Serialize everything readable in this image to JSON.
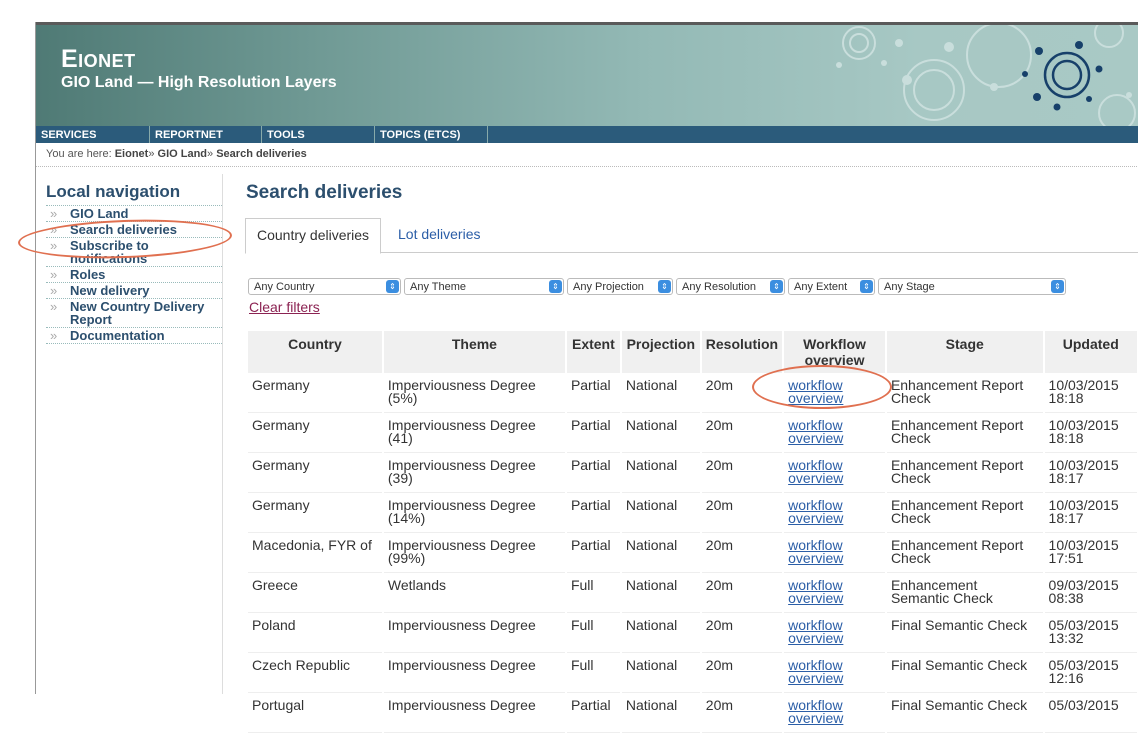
{
  "site": {
    "logo": "Eionet",
    "subtitle": "GIO Land — High Resolution Layers"
  },
  "topnav": [
    "SERVICES",
    "REPORTNET",
    "TOOLS",
    "TOPICS (ETCS)"
  ],
  "breadcrumb": {
    "prefix": "You are here:",
    "items": [
      "Eionet",
      "GIO Land",
      "Search deliveries"
    ],
    "separator": "»"
  },
  "localnav": {
    "title": "Local navigation",
    "items": [
      "GIO Land",
      "Search deliveries",
      "Subscribe to notifications",
      "Roles",
      "New delivery",
      "New Country Delivery Report",
      "Documentation"
    ]
  },
  "page": {
    "title": "Search deliveries",
    "tabs": [
      "Country deliveries",
      "Lot deliveries"
    ]
  },
  "filters": {
    "selects": [
      "Any Country",
      "Any Theme",
      "Any Projection",
      "Any Resolution",
      "Any Extent",
      "Any Stage"
    ],
    "clear": "Clear filters"
  },
  "table": {
    "headers": [
      "Country",
      "Theme",
      "Extent",
      "Projection",
      "Resolution",
      "Workflow overview",
      "Stage",
      "Updated"
    ],
    "rows": [
      [
        "Germany",
        "Imperviousness Degree (5%)",
        "Partial",
        "National",
        "20m",
        "workflow overview",
        "Enhancement Report Check",
        "10/03/2015 18:18"
      ],
      [
        "Germany",
        "Imperviousness Degree (41)",
        "Partial",
        "National",
        "20m",
        "workflow overview",
        "Enhancement Report Check",
        "10/03/2015 18:18"
      ],
      [
        "Germany",
        "Imperviousness Degree (39)",
        "Partial",
        "National",
        "20m",
        "workflow overview",
        "Enhancement Report Check",
        "10/03/2015 18:17"
      ],
      [
        "Germany",
        "Imperviousness Degree (14%)",
        "Partial",
        "National",
        "20m",
        "workflow overview",
        "Enhancement Report Check",
        "10/03/2015 18:17"
      ],
      [
        "Macedonia, FYR of",
        "Imperviousness Degree (99%)",
        "Partial",
        "National",
        "20m",
        "workflow overview",
        "Enhancement Report Check",
        "10/03/2015 17:51"
      ],
      [
        "Greece",
        "Wetlands",
        "Full",
        "National",
        "20m",
        "workflow overview",
        "Enhancement Semantic Check",
        "09/03/2015 08:38"
      ],
      [
        "Poland",
        "Imperviousness Degree",
        "Full",
        "National",
        "20m",
        "workflow overview",
        "Final Semantic Check",
        "05/03/2015 13:32"
      ],
      [
        "Czech Republic",
        "Imperviousness Degree",
        "Full",
        "National",
        "20m",
        "workflow overview",
        "Final Semantic Check",
        "05/03/2015 12:16"
      ],
      [
        "Portugal",
        "Imperviousness Degree",
        "Partial",
        "National",
        "20m",
        "workflow overview",
        "Final Semantic Check",
        "05/03/2015"
      ]
    ]
  },
  "colors": {
    "nav_bg": "#2b5b7b",
    "heading": "#2c4f6e",
    "link": "#2b5ea7",
    "highlight": "#e07050"
  }
}
